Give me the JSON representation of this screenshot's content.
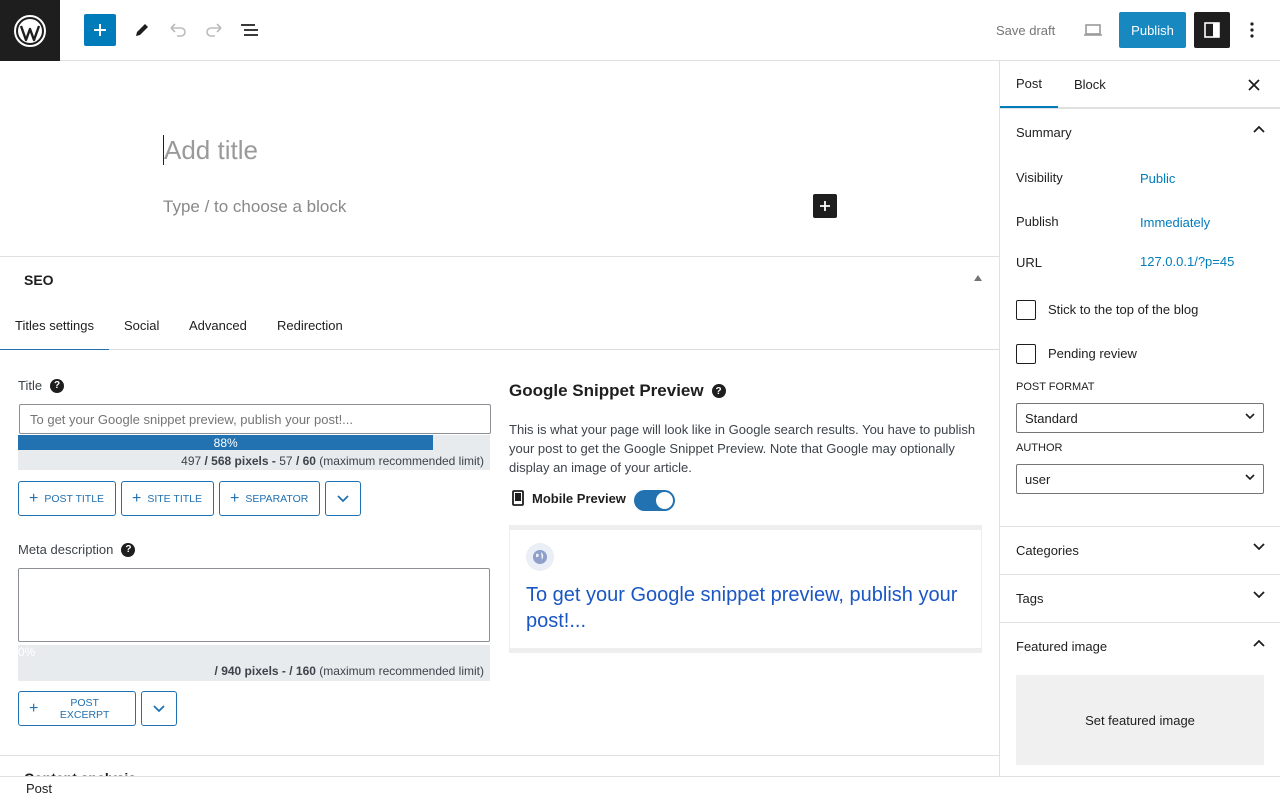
{
  "topbar": {
    "save_draft": "Save draft",
    "publish": "Publish"
  },
  "editor": {
    "title_placeholder": "Add title",
    "block_placeholder": "Type / to choose a block"
  },
  "seo": {
    "heading": "SEO",
    "tabs": [
      {
        "label": "Titles settings",
        "active": true
      },
      {
        "label": "Social",
        "active": false
      },
      {
        "label": "Advanced",
        "active": false
      },
      {
        "label": "Redirection",
        "active": false
      }
    ],
    "title": {
      "label": "Title",
      "placeholder": "To get your Google snippet preview, publish your post!...",
      "progress_percent": 88,
      "progress_label": "88%",
      "pixels_value": "497",
      "pixels_max": "/ 568 pixels -",
      "chars_value": "57",
      "chars_max": "/ 60",
      "limit_note": "(maximum recommended limit)",
      "buttons": [
        "POST TITLE",
        "SITE TITLE",
        "SEPARATOR"
      ]
    },
    "meta": {
      "label": "Meta description",
      "progress_percent": 0,
      "progress_label": "0%",
      "pixels_max": "/ 940 pixels -",
      "chars_max": "/ 160",
      "limit_note": "(maximum recommended limit)",
      "buttons": [
        "POST EXCERPT"
      ]
    },
    "snippet": {
      "heading": "Google Snippet Preview",
      "description": "This is what your page will look like in Google search results. You have to publish your post to get the Google Snippet Preview. Note that Google may optionally display an image of your article.",
      "mobile_label": "Mobile Preview",
      "mobile_on": true,
      "link_text": "To get your Google snippet preview, publish your post!..."
    },
    "content_analysis": "Content analysis"
  },
  "sidebar": {
    "tabs": [
      {
        "label": "Post",
        "active": true
      },
      {
        "label": "Block",
        "active": false
      }
    ],
    "summary": {
      "heading": "Summary",
      "rows": [
        {
          "label": "Visibility",
          "value": "Public"
        },
        {
          "label": "Publish",
          "value": "Immediately"
        },
        {
          "label": "URL",
          "value": "127.0.0.1/?p=45"
        }
      ],
      "checks": [
        "Stick to the top of the blog",
        "Pending review"
      ],
      "post_format_label": "POST FORMAT",
      "post_format_value": "Standard",
      "author_label": "AUTHOR",
      "author_value": "user"
    },
    "panels": {
      "categories": "Categories",
      "tags": "Tags",
      "featured_image": "Featured image",
      "set_featured": "Set featured image"
    }
  },
  "footer": {
    "breadcrumb": "Post"
  },
  "colors": {
    "accent": "#007cba",
    "seo_blue": "#2271b1",
    "snippet_link": "#1a57c4"
  }
}
